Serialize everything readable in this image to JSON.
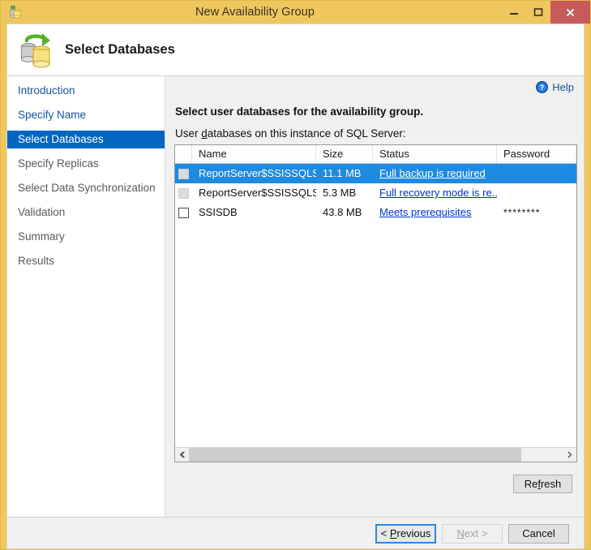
{
  "window": {
    "title": "New Availability Group",
    "app_icon": "database-icon",
    "controls": {
      "minimize": "minimize-icon",
      "maximize": "maximize-icon",
      "close": "close-icon"
    }
  },
  "header": {
    "icon": "databases-sync-icon",
    "title": "Select Databases"
  },
  "sidebar": {
    "items": [
      {
        "label": "Introduction",
        "state": "link"
      },
      {
        "label": "Specify Name",
        "state": "link"
      },
      {
        "label": "Select Databases",
        "state": "selected"
      },
      {
        "label": "Specify Replicas",
        "state": "disabled"
      },
      {
        "label": "Select Data Synchronization",
        "state": "disabled"
      },
      {
        "label": "Validation",
        "state": "disabled"
      },
      {
        "label": "Summary",
        "state": "disabled"
      },
      {
        "label": "Results",
        "state": "disabled"
      }
    ]
  },
  "content": {
    "help": {
      "label": "Help",
      "icon": "help-circle-icon"
    },
    "lead_text": "Select user databases for the availability group.",
    "list_label_before": "User ",
    "list_label_accel": "d",
    "list_label_after": "atabases on this instance of SQL Server:",
    "columns": [
      "",
      "Name",
      "Size",
      "Status",
      "Password"
    ],
    "rows": [
      {
        "checkbox": "unchecked-disabled",
        "name": "ReportServer$SSISSQLSER...",
        "size": "11.1 MB",
        "status": "Full backup is required",
        "password": "",
        "selected": true
      },
      {
        "checkbox": "unchecked-disabled",
        "name": "ReportServer$SSISSQLSER...",
        "size": "5.3 MB",
        "status": "Full recovery mode is re...",
        "password": "",
        "selected": false
      },
      {
        "checkbox": "unchecked-enabled",
        "name": "SSISDB",
        "size": "43.8 MB",
        "status": "Meets prerequisites",
        "password": "********",
        "selected": false
      }
    ],
    "scrollbar": {
      "left_arrow": "chevron-left-icon",
      "right_arrow": "chevron-right-icon"
    },
    "refresh": {
      "before": "Re",
      "accel": "f",
      "after": "resh"
    }
  },
  "footer": {
    "previous": {
      "before": "< ",
      "accel": "P",
      "after": "revious",
      "state": "focused"
    },
    "next": {
      "before": "",
      "accel": "N",
      "after": "ext >",
      "state": "disabled"
    },
    "cancel": {
      "before": "Cancel",
      "accel": "",
      "after": "",
      "state": "normal"
    }
  },
  "colors": {
    "titlebar": "#efc75e",
    "close_button": "#c75b5b",
    "sidebar_selected": "#0066c0",
    "row_selected": "#1e8ae0",
    "link": "#14549e",
    "grid_link": "#0033cc",
    "content_bg": "#f0f0f0"
  }
}
